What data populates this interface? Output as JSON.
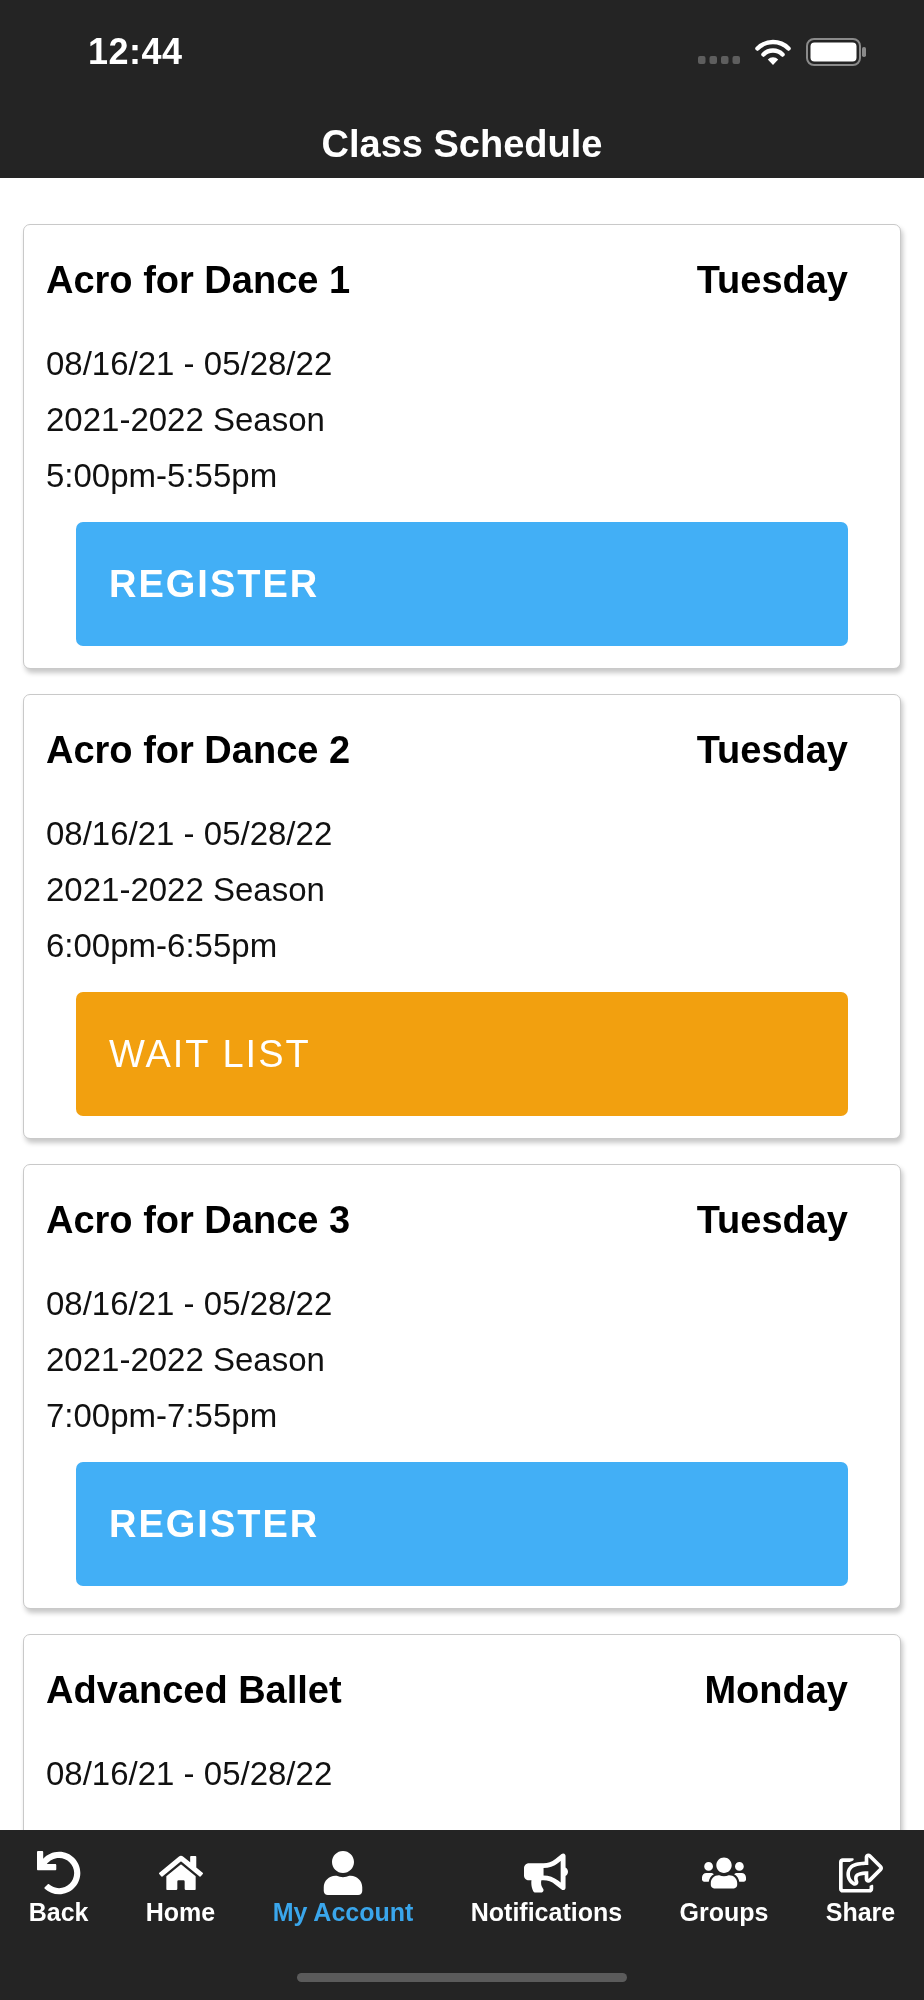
{
  "status_bar": {
    "time": "12:44"
  },
  "header": {
    "title": "Class Schedule"
  },
  "classes": [
    {
      "name": "Acro for Dance 1",
      "day": "Tuesday",
      "dates": "08/16/21 - 05/28/22",
      "season": "2021-2022 Season",
      "time": "5:00pm-5:55pm",
      "action": {
        "kind": "register",
        "label": "REGISTER"
      }
    },
    {
      "name": "Acro for Dance 2",
      "day": "Tuesday",
      "dates": "08/16/21 - 05/28/22",
      "season": "2021-2022 Season",
      "time": "6:00pm-6:55pm",
      "action": {
        "kind": "waitlist",
        "label": "WAIT LIST"
      }
    },
    {
      "name": "Acro for Dance 3",
      "day": "Tuesday",
      "dates": "08/16/21 - 05/28/22",
      "season": "2021-2022 Season",
      "time": "7:00pm-7:55pm",
      "action": {
        "kind": "register",
        "label": "REGISTER"
      }
    },
    {
      "name": "Advanced Ballet",
      "day": "Monday",
      "dates": "08/16/21 - 05/28/22"
    }
  ],
  "tab_bar": [
    {
      "kind": "back",
      "label": "Back",
      "selected": false
    },
    {
      "kind": "home",
      "label": "Home",
      "selected": false
    },
    {
      "kind": "account",
      "label": "My Account",
      "selected": true
    },
    {
      "kind": "notifications",
      "label": "Notifications",
      "selected": false
    },
    {
      "kind": "groups",
      "label": "Groups",
      "selected": false
    },
    {
      "kind": "share",
      "label": "Share",
      "selected": false
    }
  ]
}
